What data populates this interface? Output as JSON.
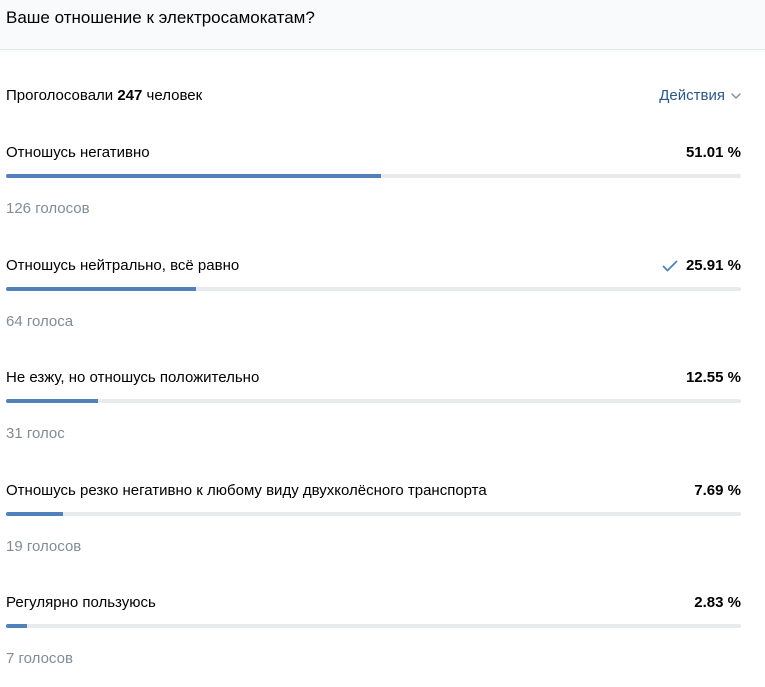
{
  "poll": {
    "title": "Ваше отношение к электросамокатам?",
    "summary_prefix": "Проголосовали",
    "total": "247",
    "summary_suffix": "человек",
    "actions_label": "Действия",
    "accent_color": "#5181b8",
    "link_color": "#2a5885",
    "options": [
      {
        "label": "Отношусь негативно",
        "percent_text": "51.01 %",
        "percent": 51.01,
        "votes_text": "126 голосов",
        "selected": false
      },
      {
        "label": "Отношусь нейтрально, всё равно",
        "percent_text": "25.91 %",
        "percent": 25.91,
        "votes_text": "64 голоса",
        "selected": true
      },
      {
        "label": "Не езжу, но отношусь положительно",
        "percent_text": "12.55 %",
        "percent": 12.55,
        "votes_text": "31 голос",
        "selected": false
      },
      {
        "label": "Отношусь резко негативно к любому виду двухколёсного транспорта",
        "percent_text": "7.69 %",
        "percent": 7.69,
        "votes_text": "19 голосов",
        "selected": false
      },
      {
        "label": "Регулярно пользуюсь",
        "percent_text": "2.83 %",
        "percent": 2.83,
        "votes_text": "7 голосов",
        "selected": false
      }
    ]
  }
}
